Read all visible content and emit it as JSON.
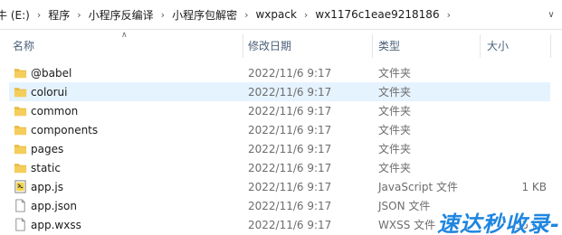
{
  "breadcrumb": {
    "items": [
      "牛 (E:)",
      "程序",
      "小程序反编译",
      "小程序包解密",
      "wxpack",
      "wx1176c1eae9218186"
    ]
  },
  "columns": {
    "name": "名称",
    "date": "修改日期",
    "type": "类型",
    "size": "大小"
  },
  "files": [
    {
      "name": "@babel",
      "date": "2022/11/6 9:17",
      "type": "文件夹",
      "size": "",
      "icon": "folder-icon"
    },
    {
      "name": "colorui",
      "date": "2022/11/6 9:17",
      "type": "文件夹",
      "size": "",
      "icon": "folder-icon",
      "selected": true
    },
    {
      "name": "common",
      "date": "2022/11/6 9:17",
      "type": "文件夹",
      "size": "",
      "icon": "folder-icon"
    },
    {
      "name": "components",
      "date": "2022/11/6 9:17",
      "type": "文件夹",
      "size": "",
      "icon": "folder-icon"
    },
    {
      "name": "pages",
      "date": "2022/11/6 9:17",
      "type": "文件夹",
      "size": "",
      "icon": "folder-icon"
    },
    {
      "name": "static",
      "date": "2022/11/6 9:17",
      "type": "文件夹",
      "size": "",
      "icon": "folder-icon"
    },
    {
      "name": "app.js",
      "date": "2022/11/6 9:17",
      "type": "JavaScript 文件",
      "size": "1 KB",
      "icon": "js-file-icon"
    },
    {
      "name": "app.json",
      "date": "2022/11/6 9:17",
      "type": "JSON 文件",
      "size": "",
      "icon": "json-file-icon"
    },
    {
      "name": "app.wxss",
      "date": "2022/11/6 9:17",
      "type": "WXSS 文件",
      "size": "135 KB",
      "icon": "wxss-file-icon"
    }
  ],
  "watermark": {
    "text": "速达秒收录-"
  },
  "colors": {
    "folder": "#e8b83c",
    "selected_row": "#e5f3ff",
    "header_text": "#4c607a",
    "watermark": "#1f86e0"
  }
}
